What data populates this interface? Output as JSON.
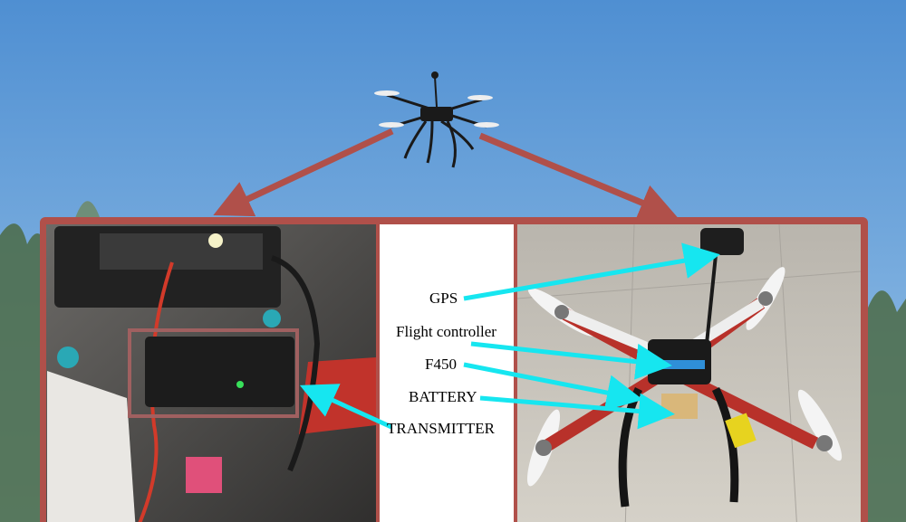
{
  "labels": {
    "gps": "GPS",
    "flight_controller": "Flight controller",
    "f450": "F450",
    "battery": "BATTERY",
    "transmitter": "TRANSMITTER"
  },
  "colors": {
    "sky_top": "#4f8fd2",
    "sky_bottom": "#8fbce4",
    "frame_red": "#b0504a",
    "arrow_cyan": "#16e6f0",
    "drone_frame": "#9b2a26",
    "drone_black": "#1a1a1a"
  }
}
